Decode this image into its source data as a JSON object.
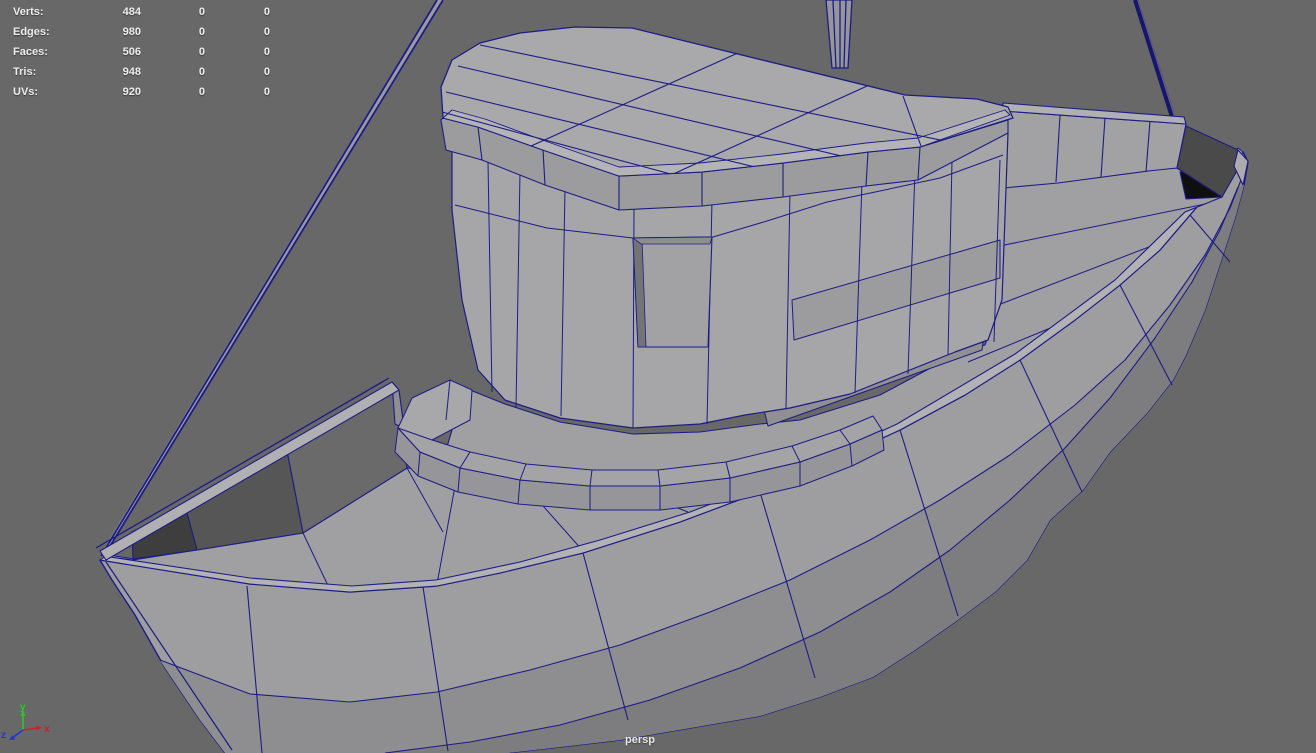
{
  "viewport": {
    "camera_label": "persp"
  },
  "hud": {
    "rows": [
      {
        "label": "Verts:",
        "values": [
          "484",
          "0",
          "0"
        ]
      },
      {
        "label": "Edges:",
        "values": [
          "980",
          "0",
          "0"
        ]
      },
      {
        "label": "Faces:",
        "values": [
          "506",
          "0",
          "0"
        ]
      },
      {
        "label": "Tris:",
        "values": [
          "948",
          "0",
          "0"
        ]
      },
      {
        "label": "UVs:",
        "values": [
          "920",
          "0",
          "0"
        ]
      }
    ]
  },
  "axis_gizmo": {
    "x_label": "x",
    "y_label": "y",
    "z_label": "z",
    "x_color": "#cc2222",
    "y_color": "#22cc22",
    "z_color": "#2233dd"
  },
  "colors": {
    "viewport_background": "#686868",
    "wireframe": "#1c1c86",
    "face_base": "#a6a6a8",
    "face_light": "#b2b2b4",
    "face_mid": "#9a9a9c",
    "face_dark": "#8e8e90",
    "face_darker": "#7d7d7f",
    "inner_shadow_dark": "#3e3e3e",
    "inner_shadow_mid": "#565656",
    "inner_shadow_light": "#6a6a6a",
    "stern_shadow": "#4a4a4a",
    "stern_black": "#0f0f0f",
    "hud_text": "#ededed"
  }
}
